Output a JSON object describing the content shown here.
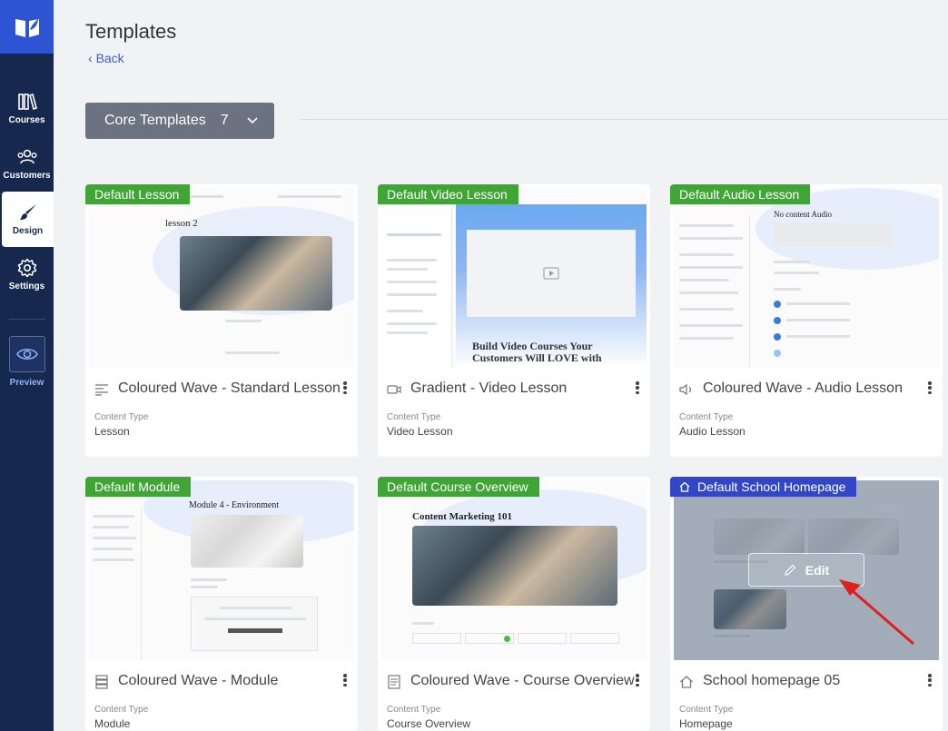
{
  "sidebar": {
    "items": [
      {
        "label": "Courses",
        "icon": "books-icon"
      },
      {
        "label": "Customers",
        "icon": "users-icon"
      },
      {
        "label": "Design",
        "icon": "brush-icon"
      },
      {
        "label": "Settings",
        "icon": "gear-icon"
      }
    ],
    "preview_label": "Preview"
  },
  "header": {
    "title": "Templates",
    "back_label": "Back"
  },
  "filter": {
    "label": "Core Templates",
    "count": "7"
  },
  "content_type_label": "Content Type",
  "cards": [
    {
      "badge": "Default Lesson",
      "title": "Coloured Wave - Standard Lesson",
      "content_type": "Lesson",
      "thumb": {
        "heading": "lesson 2"
      }
    },
    {
      "badge": "Default Video Lesson",
      "title": "Gradient - Video Lesson",
      "content_type": "Video Lesson",
      "thumb": {
        "heading": "Build Video Courses Your Customers Will LOVE with Thrive Apprentice"
      }
    },
    {
      "badge": "Default Audio Lesson",
      "title": "Coloured Wave - Audio Lesson",
      "content_type": "Audio Lesson",
      "thumb": {
        "heading": "No content Audio"
      }
    },
    {
      "badge": "Default Module",
      "title": "Coloured Wave - Module",
      "content_type": "Module",
      "thumb": {
        "heading": "Module 4 - Environment"
      }
    },
    {
      "badge": "Default Course Overview",
      "title": "Coloured Wave - Course Overview",
      "content_type": "Course Overview",
      "thumb": {
        "heading": "Content Marketing 101"
      }
    },
    {
      "badge": "Default School Homepage",
      "title": "School homepage 05",
      "content_type": "Homepage",
      "edit_label": "Edit"
    }
  ],
  "colors": {
    "sidebar": "#16284d",
    "logo": "#2e54d4",
    "badge_green": "#3fa535",
    "badge_blue": "#3147c5",
    "link": "#3b5bcc",
    "annotation_arrow": "#e0201c"
  }
}
